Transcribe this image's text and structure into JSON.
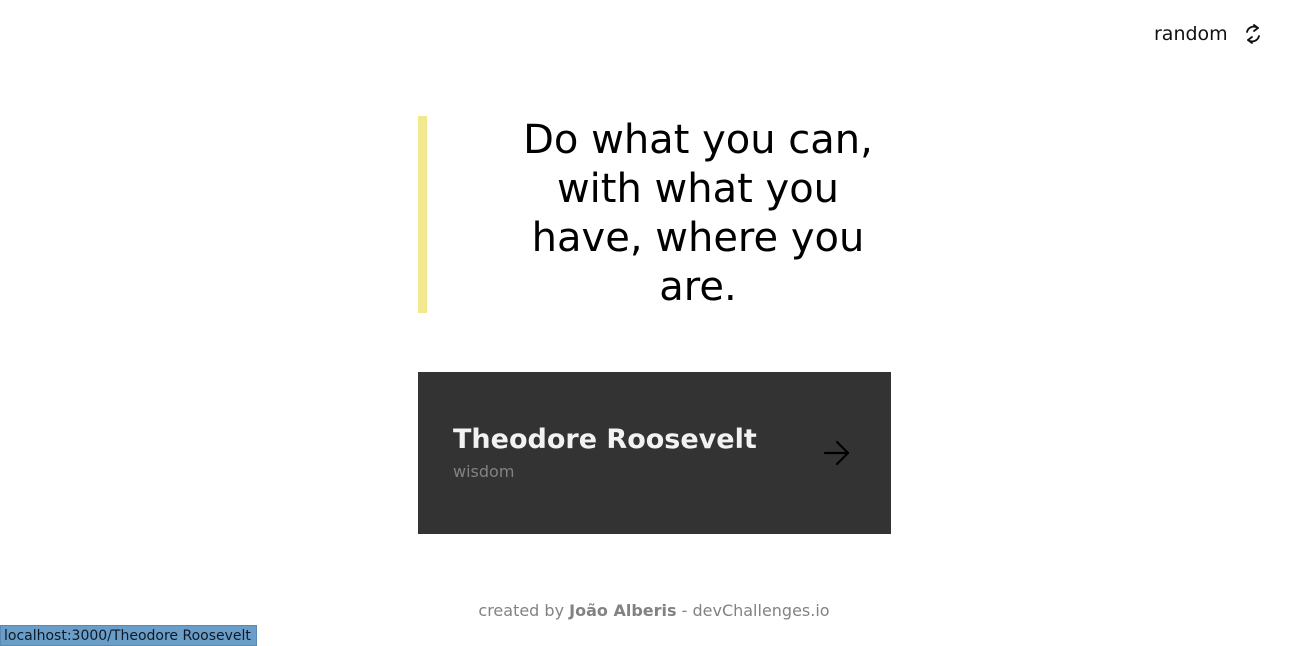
{
  "header": {
    "random_label": "random",
    "random_icon": "refresh-icon"
  },
  "quote": {
    "text": "Do what you can, with what you have, where you are.",
    "accent_color": "#F2E98E"
  },
  "author_card": {
    "name": "Theodore Roosevelt",
    "genre": "wisdom",
    "arrow_icon": "arrow-right-icon",
    "background": "#333333"
  },
  "footer": {
    "prefix": "created by ",
    "author": "João Alberis",
    "separator": " - ",
    "site": "devChallenges.io"
  },
  "status_bar": {
    "url": "localhost:3000/Theodore Roosevelt"
  }
}
